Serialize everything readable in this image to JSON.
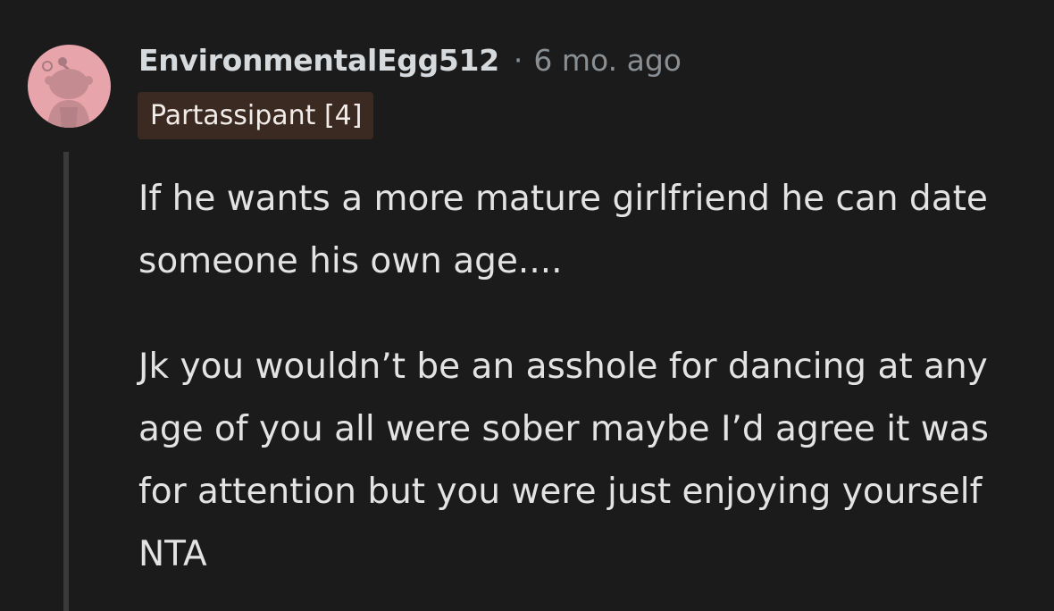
{
  "comment": {
    "username": "EnvironmentalEgg512",
    "separator": "·",
    "timestamp": "6 mo. ago",
    "flair": "Partassipant [4]",
    "paragraphs": [
      "If he wants a more mature girlfriend he can date someone his own age....",
      "Jk you wouldn’t be an asshole for dancing at any age of you all were sober maybe I’d agree it was for attention but you were just enjoying yourself NTA"
    ],
    "avatar_icon": "snoo-avatar-icon"
  },
  "colors": {
    "background": "#1b1b1b",
    "avatar_bg": "#e7a5ab",
    "flair_bg": "#3b2a22",
    "thread_line": "#3a3a3a",
    "muted_text": "#8a8f93"
  }
}
